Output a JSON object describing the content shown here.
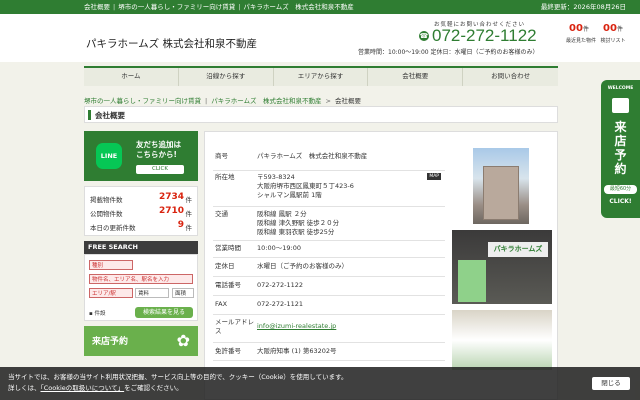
{
  "topbar": {
    "links": [
      "会社概要",
      "堺市の一人暮らし・ファミリー向け賃貸",
      "パキラホームズ　株式会社和泉不動産"
    ],
    "date": "最終更新：2026年08月26日"
  },
  "header": {
    "logo": "パキラホームズ 株式会社和泉不動産",
    "contact_note": "お気軽にお問い合わせください",
    "phone": "072-272-1122",
    "hours": "営業時間：10:00〜19:00 定休日：水曜日（ご予約のお客様のみ）",
    "counters": [
      {
        "value": "00",
        "unit": "件",
        "label": "最近見た物件"
      },
      {
        "value": "00",
        "unit": "件",
        "label": "検討リスト"
      }
    ]
  },
  "nav": [
    "ホーム",
    "沿線から探す",
    "エリアから探す",
    "会社概要",
    "お問い合わせ"
  ],
  "breadcrumb": {
    "items": [
      "堺市の一人暮らし・ファミリー向け賃貸",
      "パキラホームズ　株式会社和泉不動産"
    ],
    "current": "会社概要"
  },
  "page_title": "会社概要",
  "sidebar": {
    "line": {
      "logo": "LINE",
      "text1": "友だち追加は",
      "text2": "こちらから!",
      "click": "CLICK"
    },
    "stats": [
      {
        "label": "掲載物件数",
        "value": "2734",
        "unit": "件"
      },
      {
        "label": "公開物件数",
        "value": "2710",
        "unit": "件"
      },
      {
        "label": "本日の更新件数",
        "value": "9",
        "unit": "件"
      }
    ],
    "free_search": {
      "title": "FREE SEARCH",
      "type_placeholder": "種別",
      "keyword_placeholder": "物件名、エリア名、駅名を入力",
      "area_placeholder": "エリア/駅",
      "rent_placeholder": "賃料",
      "layout_placeholder": "面積",
      "checkbox": "件設",
      "button": "検索結果を見る"
    },
    "visit_button": "来店予約"
  },
  "company": {
    "rows": [
      {
        "label": "商号",
        "lines": [
          "パキラホームズ　株式会社和泉不動産"
        ]
      },
      {
        "label": "所在地",
        "lines": [
          "〒593-8324",
          "大阪府堺市西区鳳東町５丁423-6",
          "シャルマン鳳駅前 1階"
        ],
        "map": "MAP"
      },
      {
        "label": "交通",
        "lines": [
          "阪和線 鳳駅 ２分",
          "阪和線 津久野駅 徒歩２０分",
          "阪和線 東羽衣駅 徒歩25分"
        ]
      },
      {
        "label": "営業時間",
        "lines": [
          "10:00～19:00"
        ]
      },
      {
        "label": "定休日",
        "lines": [
          "水曜日（ご予約のお客様のみ）"
        ]
      },
      {
        "label": "電話番号",
        "lines": [
          "072-272-1122"
        ]
      },
      {
        "label": "FAX",
        "lines": [
          "072-272-1121"
        ]
      },
      {
        "label": "メールアドレス",
        "lines": [
          "info@izumi-realestate.jp"
        ],
        "email": true
      },
      {
        "label": "免許番号",
        "lines": [
          "大阪府知事 (1) 第63202号"
        ]
      }
    ],
    "photo_sign": "パキラホームズ"
  },
  "reserve_tab": {
    "welcome": "WELCOME",
    "text": "来店予約",
    "minutes": "最短60分",
    "click": "CLICK!"
  },
  "cookie": {
    "line1": "当サイトでは、お客様の当サイト利用状況把握、サービス向上等の目的で、クッキー（Cookie）を使用しています。",
    "line2_pre": "詳しくは、",
    "link": "「Cookieの取扱いについて」",
    "line2_post": "をご確認ください。",
    "close": "閉じる"
  },
  "colors": {
    "brand": "#2f7d32",
    "accent": "#d9230f",
    "light_green": "#6ab04c"
  }
}
